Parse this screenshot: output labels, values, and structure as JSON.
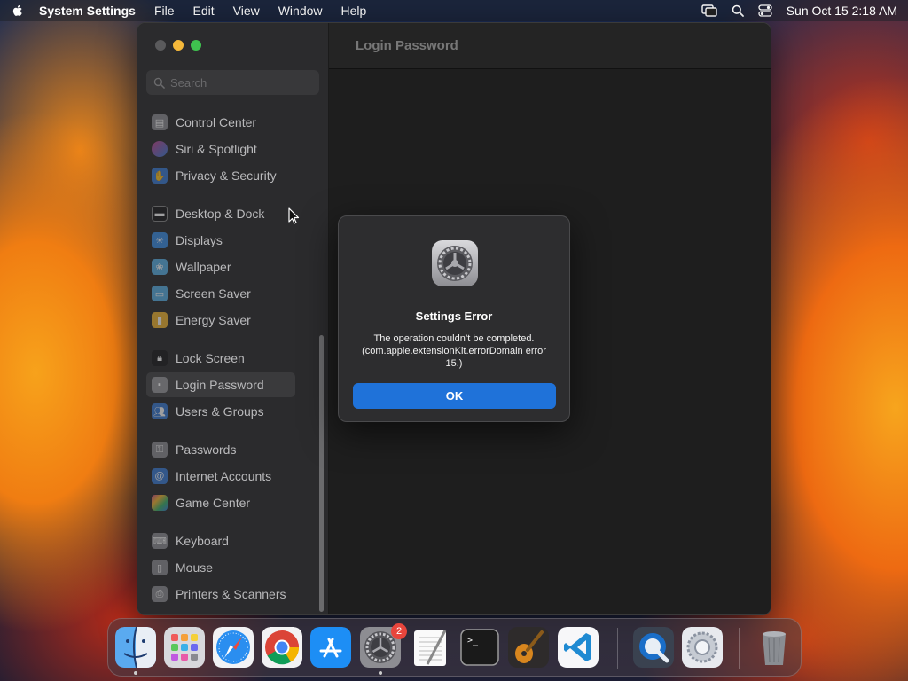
{
  "menubar": {
    "app_name": "System Settings",
    "menus": [
      "File",
      "Edit",
      "View",
      "Window",
      "Help"
    ],
    "clock": "Sun Oct 15  2:18 AM"
  },
  "window": {
    "search_placeholder": "Search",
    "header_title": "Login Password",
    "sidebar": [
      {
        "label": "Control Center",
        "icon": "control-center-icon",
        "color": "#8e8e93"
      },
      {
        "label": "Siri & Spotlight",
        "icon": "siri-icon",
        "color": "#c2458e"
      },
      {
        "label": "Privacy & Security",
        "icon": "hand-icon",
        "color": "#3a7bd5"
      },
      {
        "label": "Desktop & Dock",
        "icon": "dock-icon",
        "color": "#1c1c1e"
      },
      {
        "label": "Displays",
        "icon": "sun-icon",
        "color": "#3a8ee6"
      },
      {
        "label": "Wallpaper",
        "icon": "wallpaper-icon",
        "color": "#5ab0e6"
      },
      {
        "label": "Screen Saver",
        "icon": "screen-saver-icon",
        "color": "#5ab0e6"
      },
      {
        "label": "Energy Saver",
        "icon": "battery-icon",
        "color": "#f2b632"
      },
      {
        "label": "Lock Screen",
        "icon": "lock-icon",
        "color": "#1c1c1e"
      },
      {
        "label": "Login Password",
        "icon": "password-icon",
        "color": "#8e8e93"
      },
      {
        "label": "Users & Groups",
        "icon": "users-icon",
        "color": "#3a7bd5"
      },
      {
        "label": "Passwords",
        "icon": "key-icon",
        "color": "#8e8e93"
      },
      {
        "label": "Internet Accounts",
        "icon": "at-icon",
        "color": "#3a7bd5"
      },
      {
        "label": "Game Center",
        "icon": "game-center-icon",
        "color": "#d04a8a"
      },
      {
        "label": "Keyboard",
        "icon": "keyboard-icon",
        "color": "#8e8e93"
      },
      {
        "label": "Mouse",
        "icon": "mouse-icon",
        "color": "#8e8e93"
      },
      {
        "label": "Printers & Scanners",
        "icon": "printer-icon",
        "color": "#8e8e93"
      }
    ],
    "selected": "Login Password"
  },
  "dialog": {
    "title": "Settings Error",
    "message": "The operation couldn’t be completed. (com.apple.extensionKit.errorDomain error 15.)",
    "ok_label": "OK"
  },
  "dock": {
    "settings_badge": "2",
    "apps": [
      "Finder",
      "Launchpad",
      "Safari",
      "Chrome",
      "App Store",
      "System Settings",
      "TextEdit",
      "Terminal",
      "GarageBand",
      "Visual Studio Code",
      "QuickTime Player",
      "System Preferences",
      "Trash"
    ]
  }
}
